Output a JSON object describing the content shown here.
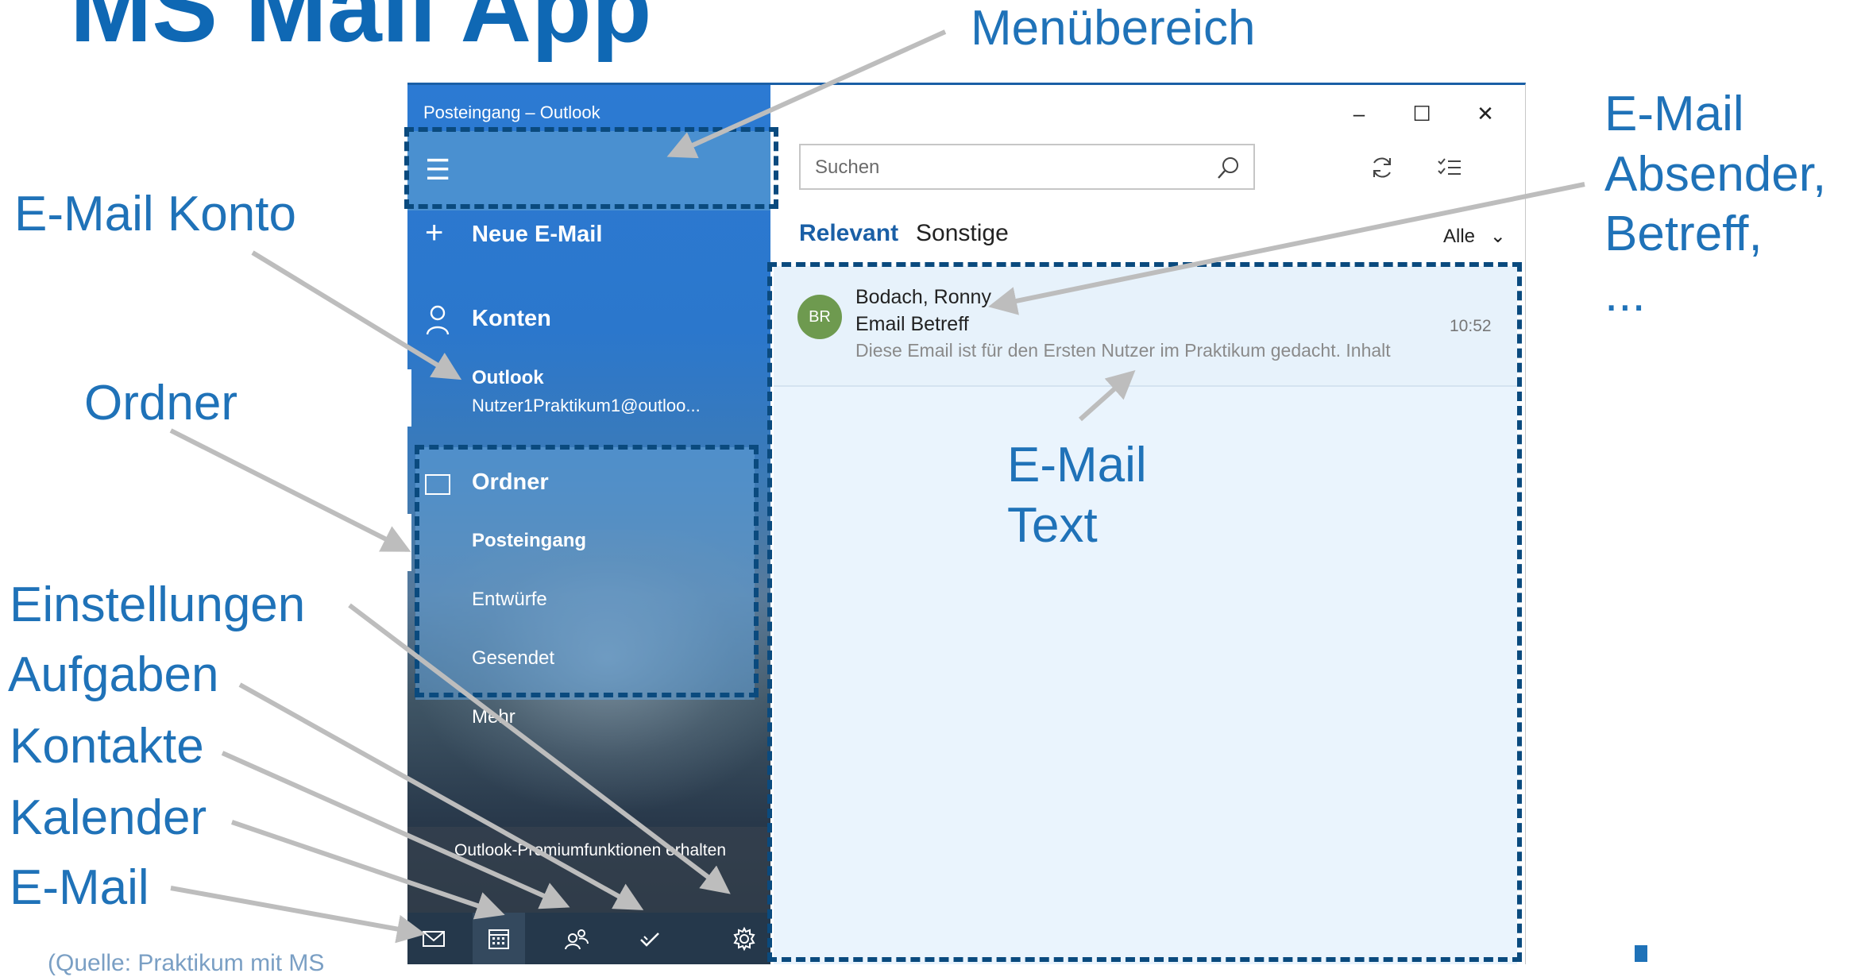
{
  "slide": {
    "title": "MS Mail App",
    "annotations": {
      "menu_area": "Menübereich",
      "email_account": "E-Mail Konto",
      "folders": "Ordner",
      "email_sender": "E-Mail\nAbsender,\nBetreff,\n...",
      "email_text": "E-Mail\nText",
      "settings": "Einstellungen",
      "tasks": "Aufgaben",
      "contacts": "Kontakte",
      "calendar": "Kalender",
      "email": "E-Mail"
    },
    "footer_partial": "(Quelle: Praktikum mit MS"
  },
  "window": {
    "title": "Posteingang – Outlook",
    "controls": {
      "minimize": "–",
      "maximize": "☐",
      "close": "✕"
    }
  },
  "sidebar": {
    "hamburger_icon": "hamburger-icon",
    "new_mail": "Neue E-Mail",
    "accounts_header": "Konten",
    "account": {
      "name": "Outlook",
      "email": "Nutzer1Praktikum1@outloo..."
    },
    "folders_header": "Ordner",
    "folders": [
      "Posteingang",
      "Entwürfe",
      "Gesendet"
    ],
    "more": "Mehr",
    "premium": "Outlook-Premiumfunktionen erhalten",
    "bottom_nav": [
      "mail-icon",
      "calendar-icon",
      "people-icon",
      "tasks-icon",
      "settings-icon"
    ]
  },
  "main": {
    "search": {
      "placeholder": "Suchen"
    },
    "toolbar": [
      "sync-icon",
      "select-icon"
    ],
    "tabs": {
      "relevant": "Relevant",
      "other": "Sonstige"
    },
    "filter": "Alle",
    "messages": [
      {
        "initials": "BR",
        "sender": "Bodach, Ronny",
        "subject": "Email Betreff",
        "time": "10:52",
        "preview": "Diese Email ist für den Ersten Nutzer im Praktikum gedacht. Inhalt"
      }
    ]
  },
  "colors": {
    "accent": "#1a5fa6",
    "annotation": "#1f72b8",
    "title": "#0f68b4",
    "dashed_box": "#0a4a7e"
  }
}
